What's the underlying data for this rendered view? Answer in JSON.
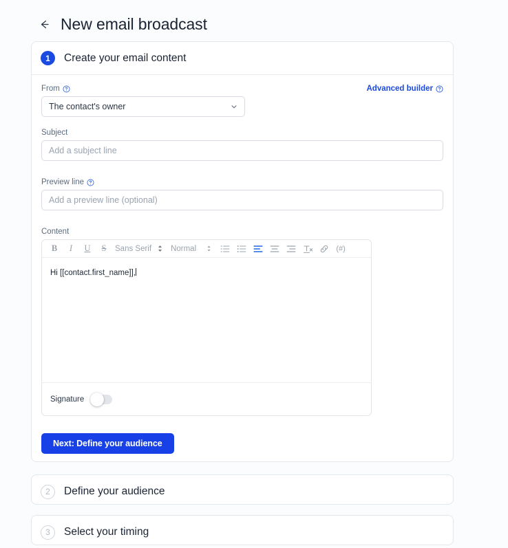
{
  "header": {
    "back_icon": "arrow-left-icon",
    "title": "New email broadcast"
  },
  "steps": [
    {
      "number": "1",
      "title": "Create your email content",
      "state": "expanded"
    },
    {
      "number": "2",
      "title": "Define your audience",
      "state": "collapsed"
    },
    {
      "number": "3",
      "title": "Select your timing",
      "state": "collapsed"
    }
  ],
  "form": {
    "from": {
      "label": "From",
      "help_icon": "help-circle-icon",
      "value": "The contact's owner",
      "chevron_icon": "chevron-down-icon"
    },
    "advanced_builder": {
      "label": "Advanced builder",
      "help_icon": "help-circle-icon"
    },
    "subject": {
      "label": "Subject",
      "value": "",
      "placeholder": "Add a subject line"
    },
    "preview_line": {
      "label": "Preview line",
      "help_icon": "help-circle-icon",
      "value": "",
      "placeholder": "Add a preview line (optional)"
    },
    "content": {
      "label": "Content",
      "body_text": "Hi [[contact.first_name]],",
      "toolbar": {
        "bold": "B",
        "italic": "I",
        "underline": "U",
        "strikethrough": "S",
        "font_family": "Sans Serif",
        "font_size": "Normal",
        "ordered_list_icon": "numbered-list-icon",
        "bullet_list_icon": "bullet-list-icon",
        "align_left_icon": "align-left-icon",
        "align_center_icon": "align-center-icon",
        "align_right_icon": "align-right-icon",
        "clear_format_icon": "clear-formatting-icon",
        "link_icon": "link-icon",
        "merge_tag_label": "(#)"
      }
    },
    "signature": {
      "label": "Signature",
      "enabled": false
    }
  },
  "actions": {
    "next_button": "Next: Define your audience"
  },
  "colors": {
    "accent": "#1740e6",
    "step_badge": "#1a4ae0",
    "link": "#1a4ae0",
    "toolbar_active": "#1a6ae0",
    "page_background": "#fbfcfd",
    "card_background": "#ffffff",
    "border": "#e3e7ec"
  }
}
